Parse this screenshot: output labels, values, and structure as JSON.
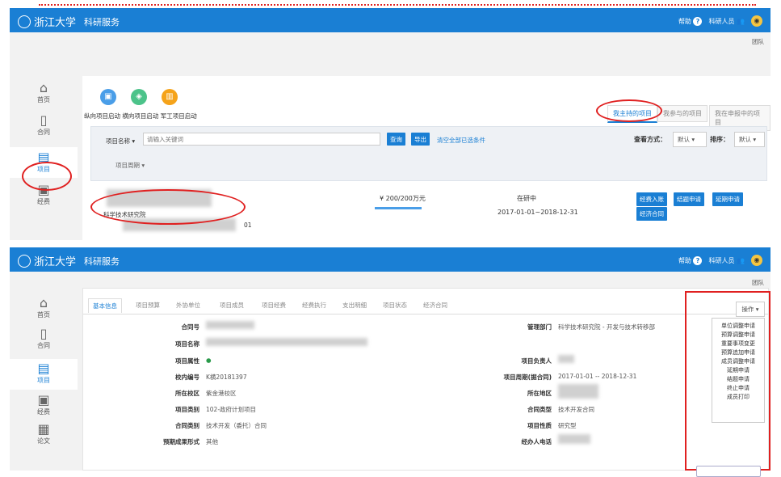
{
  "common": {
    "brand": "科研服务",
    "help": "帮助",
    "help_icon": "?",
    "role": "科研人员",
    "team": "团队"
  },
  "sidebar1": [
    {
      "icon": "home-icon",
      "glyph": "⌂",
      "label": "首页"
    },
    {
      "icon": "contract-icon",
      "glyph": "🄆",
      "label": "合同"
    },
    {
      "icon": "project-icon",
      "glyph": "▤",
      "label": "项目"
    },
    {
      "icon": "funds-icon",
      "glyph": "▣",
      "label": "经费"
    }
  ],
  "sidebar2": [
    {
      "icon": "home-icon",
      "glyph": "⌂",
      "label": "首页"
    },
    {
      "icon": "contract-icon",
      "glyph": "🄆",
      "label": "合同"
    },
    {
      "icon": "project-icon",
      "glyph": "▤",
      "label": "项目"
    },
    {
      "icon": "funds-icon",
      "glyph": "▣",
      "label": "经费"
    },
    {
      "icon": "paper-icon",
      "glyph": "▦",
      "label": "论文"
    }
  ],
  "screen1": {
    "quick": [
      "纵向项目启动",
      "横向项目启动",
      "军工项目启动"
    ],
    "tabs": [
      "我主持的项目",
      "我参与的项目",
      "我在申报中的项目"
    ],
    "filter": {
      "field_label": "项目名称",
      "placeholder": "请输入关键词",
      "query": "查询",
      "export": "导出",
      "clear": "清空全部已选条件",
      "period": "项目周期",
      "view_label": "查看方式：",
      "view_val": "默认",
      "sort_label": "排序：",
      "sort_val": "默认"
    },
    "item": {
      "org": "科学技术研究院",
      "amount": "¥ 200/200万元",
      "status": "在研中",
      "dates": "2017-01-01~2018-12-31",
      "suffix": "01",
      "actions": [
        "经费入账",
        "结题申请",
        "延期申请",
        "经济合同"
      ]
    }
  },
  "screen2": {
    "tabs": [
      "基本信息",
      "项目预算",
      "外协单位",
      "项目成员",
      "项目经费",
      "经费执行",
      "支出明细",
      "项目状态",
      "经济合同"
    ],
    "ops_label": "操作",
    "menu": [
      "单位调整申请",
      "预算调整申请",
      "重要事项变更",
      "预算追加申请",
      "成员调整申请",
      "延期申请",
      "结题申请",
      "终止申请",
      "成员打印"
    ],
    "left": [
      {
        "label": "合同号",
        "value": ""
      },
      {
        "label": "项目名称",
        "value": ""
      },
      {
        "label": "项目属性",
        "value": "●"
      },
      {
        "label": "校内编号",
        "value": "K横20181397"
      },
      {
        "label": "所在校区",
        "value": "紫金港校区"
      },
      {
        "label": "项目类别",
        "value": "102-政府计划项目"
      },
      {
        "label": "合同类别",
        "value": "技术开发（委托）合同"
      },
      {
        "label": "预期成果形式",
        "value": "其他"
      }
    ],
    "right": [
      {
        "label": "管理部门",
        "value": "科学技术研究院 - 开发与技术转移部"
      },
      {
        "label": "项目负责人",
        "value": ""
      },
      {
        "label": "项目周期(据合同)",
        "value": "2017-01-01 -- 2018-12-31"
      },
      {
        "label": "所在地区",
        "value": ""
      },
      {
        "label": "合同类型",
        "value": "技术开发合同"
      },
      {
        "label": "项目性质",
        "value": "研究型"
      },
      {
        "label": "经办人电话",
        "value": ""
      }
    ]
  }
}
